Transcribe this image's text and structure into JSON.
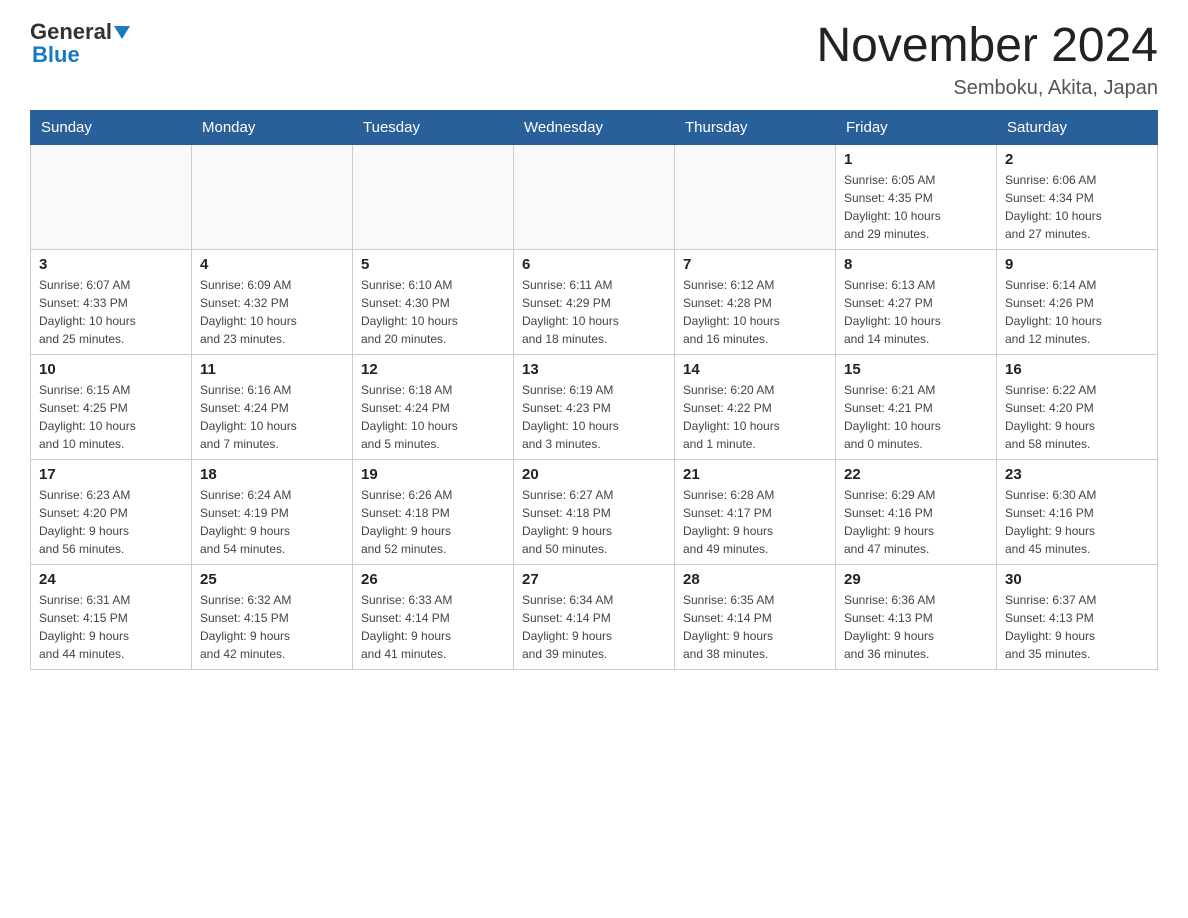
{
  "header": {
    "title": "November 2024",
    "subtitle": "Semboku, Akita, Japan"
  },
  "logo": {
    "line1": "General",
    "line2": "Blue"
  },
  "days": [
    "Sunday",
    "Monday",
    "Tuesday",
    "Wednesday",
    "Thursday",
    "Friday",
    "Saturday"
  ],
  "weeks": [
    [
      {
        "day": "",
        "info": ""
      },
      {
        "day": "",
        "info": ""
      },
      {
        "day": "",
        "info": ""
      },
      {
        "day": "",
        "info": ""
      },
      {
        "day": "",
        "info": ""
      },
      {
        "day": "1",
        "info": "Sunrise: 6:05 AM\nSunset: 4:35 PM\nDaylight: 10 hours\nand 29 minutes."
      },
      {
        "day": "2",
        "info": "Sunrise: 6:06 AM\nSunset: 4:34 PM\nDaylight: 10 hours\nand 27 minutes."
      }
    ],
    [
      {
        "day": "3",
        "info": "Sunrise: 6:07 AM\nSunset: 4:33 PM\nDaylight: 10 hours\nand 25 minutes."
      },
      {
        "day": "4",
        "info": "Sunrise: 6:09 AM\nSunset: 4:32 PM\nDaylight: 10 hours\nand 23 minutes."
      },
      {
        "day": "5",
        "info": "Sunrise: 6:10 AM\nSunset: 4:30 PM\nDaylight: 10 hours\nand 20 minutes."
      },
      {
        "day": "6",
        "info": "Sunrise: 6:11 AM\nSunset: 4:29 PM\nDaylight: 10 hours\nand 18 minutes."
      },
      {
        "day": "7",
        "info": "Sunrise: 6:12 AM\nSunset: 4:28 PM\nDaylight: 10 hours\nand 16 minutes."
      },
      {
        "day": "8",
        "info": "Sunrise: 6:13 AM\nSunset: 4:27 PM\nDaylight: 10 hours\nand 14 minutes."
      },
      {
        "day": "9",
        "info": "Sunrise: 6:14 AM\nSunset: 4:26 PM\nDaylight: 10 hours\nand 12 minutes."
      }
    ],
    [
      {
        "day": "10",
        "info": "Sunrise: 6:15 AM\nSunset: 4:25 PM\nDaylight: 10 hours\nand 10 minutes."
      },
      {
        "day": "11",
        "info": "Sunrise: 6:16 AM\nSunset: 4:24 PM\nDaylight: 10 hours\nand 7 minutes."
      },
      {
        "day": "12",
        "info": "Sunrise: 6:18 AM\nSunset: 4:24 PM\nDaylight: 10 hours\nand 5 minutes."
      },
      {
        "day": "13",
        "info": "Sunrise: 6:19 AM\nSunset: 4:23 PM\nDaylight: 10 hours\nand 3 minutes."
      },
      {
        "day": "14",
        "info": "Sunrise: 6:20 AM\nSunset: 4:22 PM\nDaylight: 10 hours\nand 1 minute."
      },
      {
        "day": "15",
        "info": "Sunrise: 6:21 AM\nSunset: 4:21 PM\nDaylight: 10 hours\nand 0 minutes."
      },
      {
        "day": "16",
        "info": "Sunrise: 6:22 AM\nSunset: 4:20 PM\nDaylight: 9 hours\nand 58 minutes."
      }
    ],
    [
      {
        "day": "17",
        "info": "Sunrise: 6:23 AM\nSunset: 4:20 PM\nDaylight: 9 hours\nand 56 minutes."
      },
      {
        "day": "18",
        "info": "Sunrise: 6:24 AM\nSunset: 4:19 PM\nDaylight: 9 hours\nand 54 minutes."
      },
      {
        "day": "19",
        "info": "Sunrise: 6:26 AM\nSunset: 4:18 PM\nDaylight: 9 hours\nand 52 minutes."
      },
      {
        "day": "20",
        "info": "Sunrise: 6:27 AM\nSunset: 4:18 PM\nDaylight: 9 hours\nand 50 minutes."
      },
      {
        "day": "21",
        "info": "Sunrise: 6:28 AM\nSunset: 4:17 PM\nDaylight: 9 hours\nand 49 minutes."
      },
      {
        "day": "22",
        "info": "Sunrise: 6:29 AM\nSunset: 4:16 PM\nDaylight: 9 hours\nand 47 minutes."
      },
      {
        "day": "23",
        "info": "Sunrise: 6:30 AM\nSunset: 4:16 PM\nDaylight: 9 hours\nand 45 minutes."
      }
    ],
    [
      {
        "day": "24",
        "info": "Sunrise: 6:31 AM\nSunset: 4:15 PM\nDaylight: 9 hours\nand 44 minutes."
      },
      {
        "day": "25",
        "info": "Sunrise: 6:32 AM\nSunset: 4:15 PM\nDaylight: 9 hours\nand 42 minutes."
      },
      {
        "day": "26",
        "info": "Sunrise: 6:33 AM\nSunset: 4:14 PM\nDaylight: 9 hours\nand 41 minutes."
      },
      {
        "day": "27",
        "info": "Sunrise: 6:34 AM\nSunset: 4:14 PM\nDaylight: 9 hours\nand 39 minutes."
      },
      {
        "day": "28",
        "info": "Sunrise: 6:35 AM\nSunset: 4:14 PM\nDaylight: 9 hours\nand 38 minutes."
      },
      {
        "day": "29",
        "info": "Sunrise: 6:36 AM\nSunset: 4:13 PM\nDaylight: 9 hours\nand 36 minutes."
      },
      {
        "day": "30",
        "info": "Sunrise: 6:37 AM\nSunset: 4:13 PM\nDaylight: 9 hours\nand 35 minutes."
      }
    ]
  ]
}
